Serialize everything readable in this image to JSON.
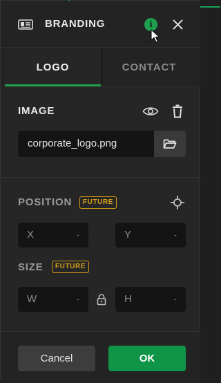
{
  "header": {
    "title": "BRANDING",
    "info_glyph": "i"
  },
  "tabs": [
    {
      "label": "LOGO",
      "active": true
    },
    {
      "label": "CONTACT",
      "active": false
    }
  ],
  "image_section": {
    "title": "IMAGE",
    "file_value": "corporate_logo.png"
  },
  "position_section": {
    "title": "POSITION",
    "badge": "FUTURE",
    "x_label": "X",
    "x_value": "-",
    "y_label": "Y",
    "y_value": "-"
  },
  "size_section": {
    "title": "SIZE",
    "badge": "FUTURE",
    "w_label": "W",
    "w_value": "-",
    "h_label": "H",
    "h_value": "-"
  },
  "footer": {
    "cancel_label": "Cancel",
    "ok_label": "OK"
  },
  "colors": {
    "accent_green": "#1f9f4f",
    "future_badge": "#d39a12",
    "panel_bg": "#262626"
  },
  "icons": [
    "id-card-icon",
    "info-icon",
    "close-icon",
    "eye-icon",
    "trash-icon",
    "folder-icon",
    "crosshair-icon",
    "lock-icon"
  ]
}
